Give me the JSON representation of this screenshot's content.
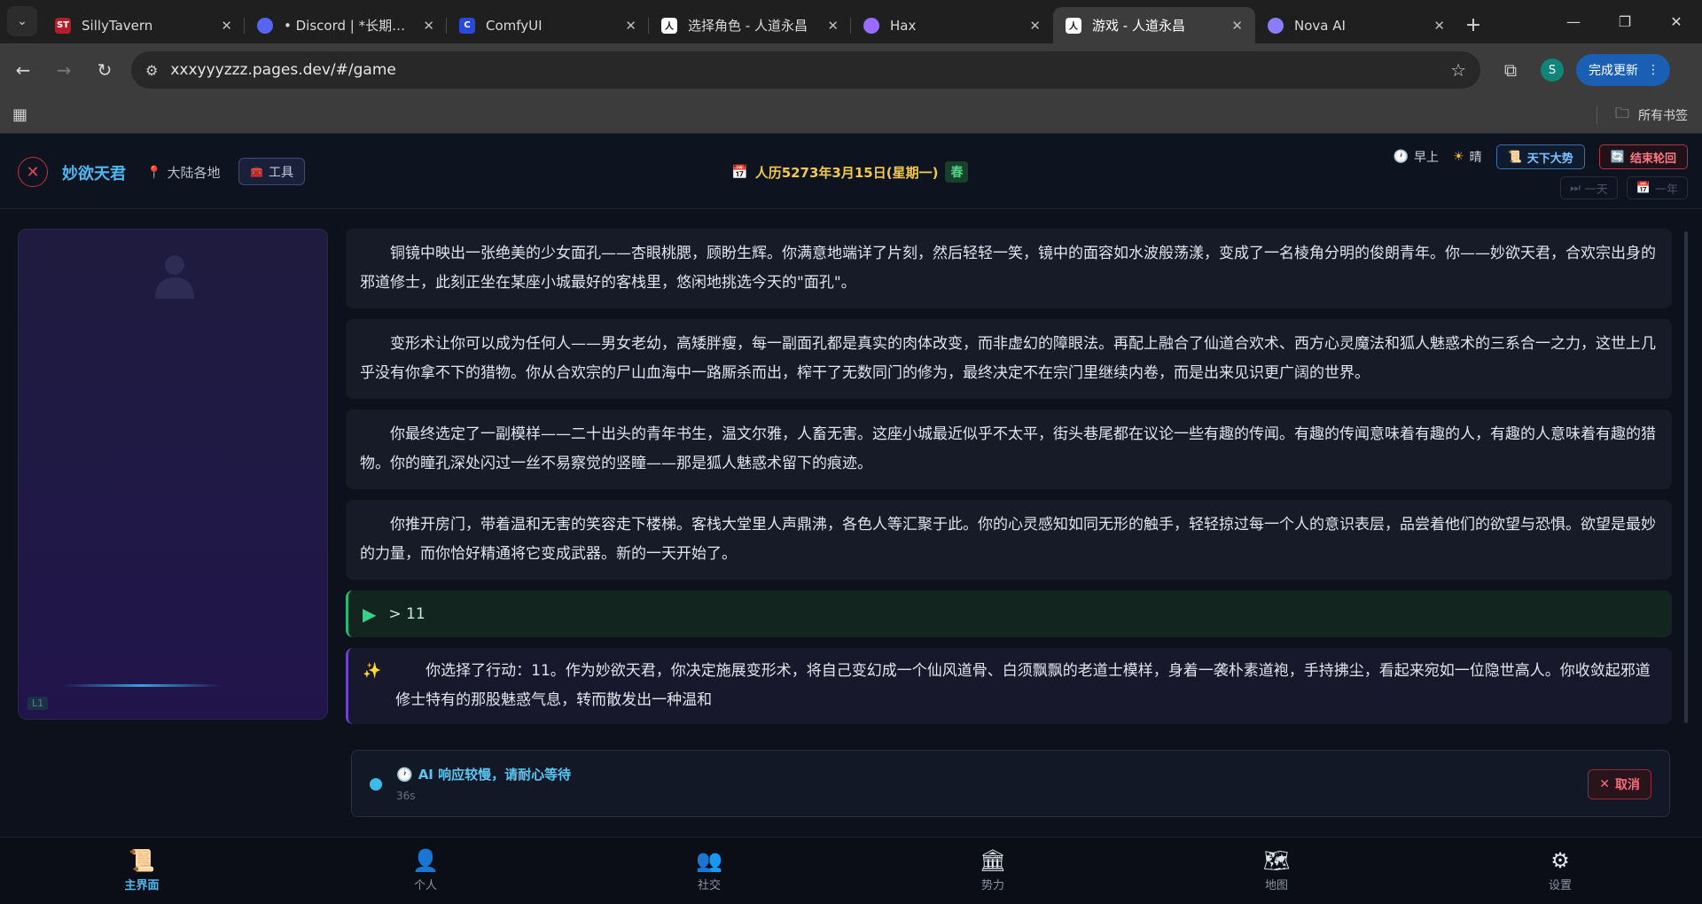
{
  "browser": {
    "tabs": [
      {
        "title": "SillyTavern",
        "fav": "ST",
        "fav_color": "#b31e2d"
      },
      {
        "title": "• Discord | *长期更新",
        "fav": "",
        "fav_color": "#5865f2"
      },
      {
        "title": "ComfyUI",
        "fav": "C",
        "fav_color": "#2b49d8"
      },
      {
        "title": "选择角色 - 人道永昌",
        "fav": "人",
        "fav_color": "#ffffff"
      },
      {
        "title": "Hax",
        "fav": "",
        "fav_color": "#9a6bff"
      },
      {
        "title": "游戏 - 人道永昌",
        "fav": "人",
        "fav_color": "#ffffff"
      },
      {
        "title": "Nova AI",
        "fav": "",
        "fav_color": "#8a7bff"
      }
    ],
    "active_tab": 5,
    "url": "xxxyyyzzz.pages.dev/#/game",
    "profile_initial": "S",
    "update_label": "完成更新",
    "bookmarks_label": "所有书签"
  },
  "header": {
    "character_name": "妙欲天君",
    "location": "大陆各地",
    "tools_label": "工具",
    "date": "人历5273年3月15日(星期一)",
    "season": "春",
    "time_of_day": "早上",
    "weather": "晴",
    "world_trend_label": "天下大势",
    "end_cycle_label": "结束轮回",
    "skip_day_label": "一天",
    "skip_year_label": "一年"
  },
  "left_panel": {
    "level_tag": "L1"
  },
  "story": {
    "paragraphs": [
      "铜镜中映出一张绝美的少女面孔——杏眼桃腮，顾盼生辉。你满意地端详了片刻，然后轻轻一笑，镜中的面容如水波般荡漾，变成了一名棱角分明的俊朗青年。你——妙欲天君，合欢宗出身的邪道修士，此刻正坐在某座小城最好的客栈里，悠闲地挑选今天的\"面孔\"。",
      "变形术让你可以成为任何人——男女老幼，高矮胖瘦，每一副面孔都是真实的肉体改变，而非虚幻的障眼法。再配上融合了仙道合欢术、西方心灵魔法和狐人魅惑术的三系合一之力，这世上几乎没有你拿不下的猎物。你从合欢宗的尸山血海中一路厮杀而出，榨干了无数同门的修为，最终决定不在宗门里继续内卷，而是出来见识更广阔的世界。",
      "你最终选定了一副模样——二十出头的青年书生，温文尔雅，人畜无害。这座小城最近似乎不太平，街头巷尾都在议论一些有趣的传闻。有趣的传闻意味着有趣的人，有趣的人意味着有趣的猎物。你的瞳孔深处闪过一丝不易察觉的竖瞳——那是狐人魅惑术留下的痕迹。",
      "你推开房门，带着温和无害的笑容走下楼梯。客栈大堂里人声鼎沸，各色人等汇聚于此。你的心灵感知如同无形的触手，轻轻掠过每一个人的意识表层，品尝着他们的欲望与恐惧。欲望是最妙的力量，而你恰好精通将它变成武器。新的一天开始了。"
    ],
    "action": "> 11",
    "response": "你选择了行动：11。作为妙欲天君，你决定施展变形术，将自己变幻成一个仙风道骨、白须飘飘的老道士模样，身着一袭朴素道袍，手持拂尘，看起来宛如一位隐世高人。你收敛起邪道修士特有的那股魅惑气息，转而散发出一种温和"
  },
  "waiting": {
    "message": "AI 响应较慢，请耐心等待",
    "elapsed": "36s",
    "cancel_label": "取消"
  },
  "bottom_nav": [
    {
      "label": "主界面",
      "icon": "scroll-icon",
      "glyph": "📜",
      "active": true
    },
    {
      "label": "个人",
      "icon": "person-icon",
      "glyph": "👤",
      "active": false
    },
    {
      "label": "社交",
      "icon": "people-icon",
      "glyph": "👥",
      "active": false
    },
    {
      "label": "势力",
      "icon": "bank-icon",
      "glyph": "🏛",
      "active": false
    },
    {
      "label": "地图",
      "icon": "map-icon",
      "glyph": "🗺",
      "active": false
    },
    {
      "label": "设置",
      "icon": "gear-icon",
      "glyph": "⚙",
      "active": false
    }
  ]
}
